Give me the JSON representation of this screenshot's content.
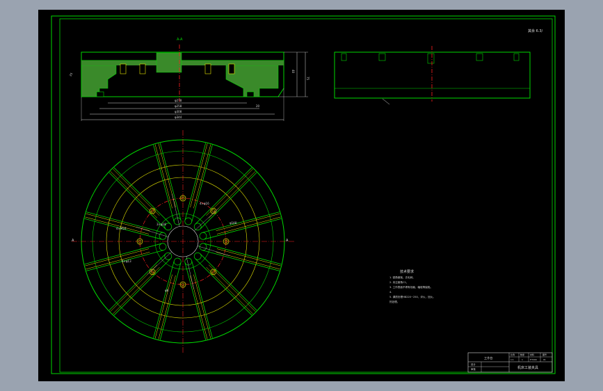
{
  "colors": {
    "background": "#9aa3b0",
    "canvas": "#000000",
    "frame": "#00d800",
    "center_line": "#ff2020",
    "dimension": "#d8d8d8",
    "secondary": "#e8e800"
  },
  "labels": {
    "section_mark": "A-A",
    "roughness_note": "其余 6.3/",
    "dim_d278": "φ278",
    "dim_d258": "φ258",
    "dim_d308": "φ308",
    "dim_d344": "φ344",
    "dim_height": "75",
    "dim_inner": "40",
    "dim_tr": "25",
    "dim_tr2": "20",
    "view_left": "A",
    "view_right": "A",
    "bolt_label_1": "4×M16",
    "bolt_label_2": "3×φ18",
    "bolt_label_3": "φ148",
    "bolt_label_4": "6×φ13",
    "bolt_label_5": "4×φ16",
    "bolt_label_6": "φ8"
  },
  "notes": {
    "title": "技术要求",
    "lines": [
      "1. 锐角倒钝，去毛刺。",
      "2. 未注倒角C1。",
      "3. 工作表面不得有划痕，磕碰等缺陷。",
      "4.",
      "5. 调质处理HB220~250，淬火，回火。",
      "热处理。"
    ]
  },
  "title_block": {
    "part_name": "工作台",
    "drawing_title": "机床工装夹具",
    "role_1": "设计",
    "role_2": "审核",
    "cells": [
      "比例",
      "数量",
      "材料",
      "图号"
    ],
    "values": [
      "1:1",
      "1",
      "HT200",
      "01"
    ]
  }
}
